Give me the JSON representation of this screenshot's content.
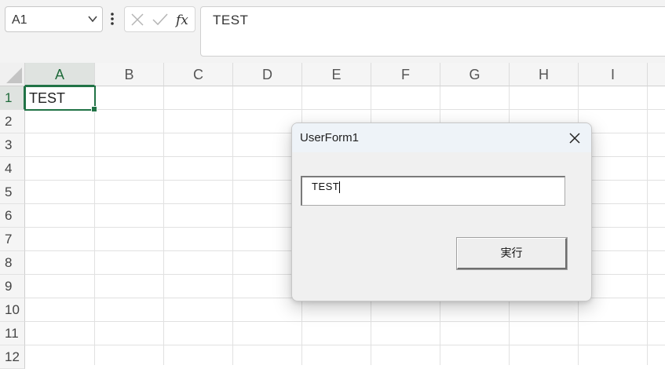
{
  "formula_bar": {
    "name_box_value": "A1",
    "formula_value": "TEST"
  },
  "sheet": {
    "columns": [
      "A",
      "B",
      "C",
      "D",
      "E",
      "F",
      "G",
      "H",
      "I"
    ],
    "rows": [
      "1",
      "2",
      "3",
      "4",
      "5",
      "6",
      "7",
      "8",
      "9",
      "10",
      "11",
      "12"
    ],
    "selected_cell": {
      "ref": "A1",
      "value": "TEST"
    }
  },
  "dialog": {
    "title": "UserForm1",
    "textbox_value": "TEST",
    "run_button_label": "実行"
  },
  "colors": {
    "accent": "#217346",
    "dialog_bg": "#f0f0f0",
    "title_bar": "#eef3f8"
  },
  "icons": [
    "chevron-down-icon",
    "more-options-icon",
    "cancel-icon",
    "check-icon",
    "fx-icon",
    "close-icon",
    "select-all-icon"
  ]
}
